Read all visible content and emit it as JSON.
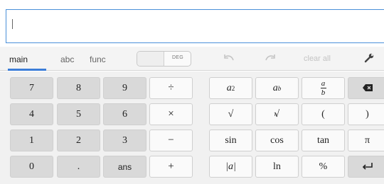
{
  "input": {
    "value": ""
  },
  "tabs": [
    {
      "label": "main",
      "active": true
    },
    {
      "label": "abc",
      "active": false
    },
    {
      "label": "func",
      "active": false
    }
  ],
  "angle_toggle": {
    "label": "DEG"
  },
  "toolbar": {
    "undo_icon": "undo-arrow-icon",
    "redo_icon": "redo-arrow-icon",
    "clear_label": "clear all",
    "settings_icon": "wrench-icon"
  },
  "keys": {
    "k7": "7",
    "k8": "8",
    "k9": "9",
    "div": "÷",
    "k4": "4",
    "k5": "5",
    "k6": "6",
    "mul": "×",
    "k1": "1",
    "k2": "2",
    "k3": "3",
    "sub": "−",
    "k0": "0",
    "dot": ".",
    "ans": "ans",
    "add": "+",
    "square_base": "a",
    "square_exp": "2",
    "power_base": "a",
    "power_exp": "b",
    "frac_num": "a",
    "frac_den": "b",
    "backspace_icon": "backspace-icon",
    "sqrt": "√",
    "nthroot_index": "n",
    "nthroot": "√",
    "lparen": "(",
    "rparen": ")",
    "sin": "sin",
    "cos": "cos",
    "tan": "tan",
    "pi": "π",
    "abs": "|a|",
    "ln": "ln",
    "percent": "%",
    "enter_icon": "enter-arrow-icon"
  },
  "colors": {
    "accent": "#3b7dd8",
    "number_key": "#d9d9d9",
    "function_key": "#fafafa",
    "disabled": "#c4c4c4"
  }
}
